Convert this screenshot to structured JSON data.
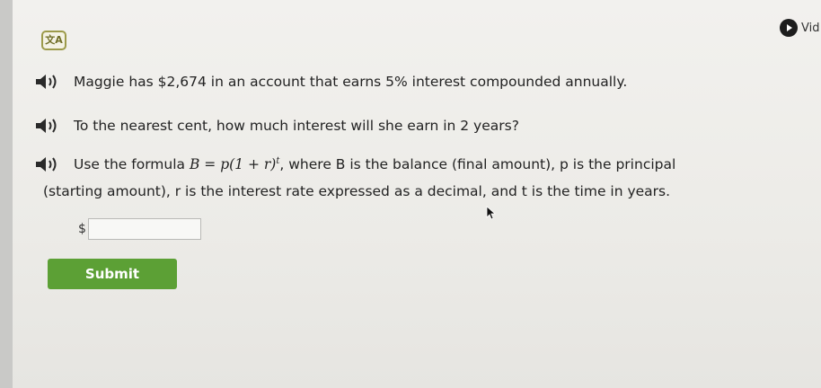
{
  "header": {
    "video_label": "Vid"
  },
  "question": {
    "line1": "Maggie has $2,674 in an account that earns 5% interest compounded annually.",
    "line2": "To the nearest cent, how much interest will she earn in 2 years?",
    "line3_prefix": "Use the formula",
    "formula_lhs": "B",
    "formula_eq": "=",
    "formula_rhs": "p(1 + r)",
    "formula_exp": "t",
    "line3_suffix": ", where B is the balance (final amount), p is the principal",
    "line4": "(starting amount), r is the interest rate expressed as a decimal, and t is the time in years."
  },
  "answer": {
    "currency_symbol": "$",
    "value": ""
  },
  "submit": {
    "label": "Submit"
  },
  "icons": {
    "translate": "translate-icon",
    "speaker": "speaker-icon",
    "video": "play-icon",
    "cursor": "mouse-pointer-icon"
  },
  "colors": {
    "submit_green": "#5ca035",
    "translate_olive": "#9c9a4a"
  }
}
